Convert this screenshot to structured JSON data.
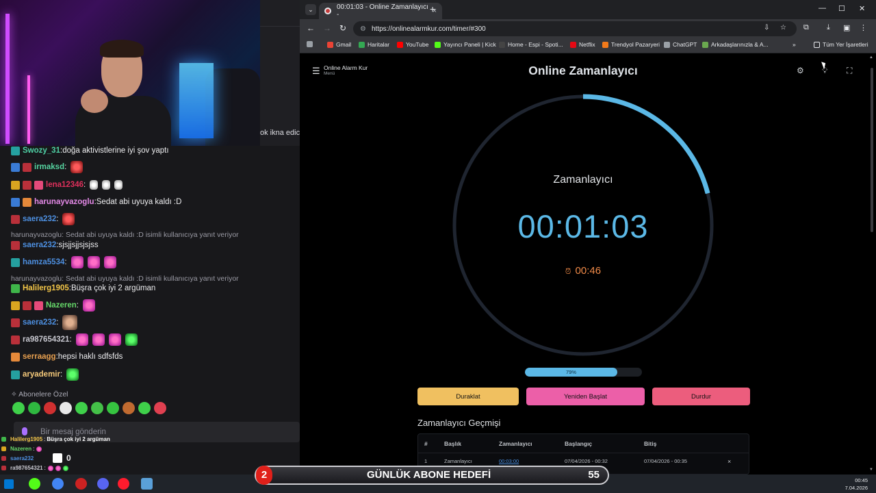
{
  "chat": {
    "overflow_fragment": "ok ikna edici",
    "messages": [
      {
        "user": "Swozy_31",
        "sep": ":",
        "text": " doğa aktivistlerine iyi şov yaptı",
        "color": "#4fd1a5"
      },
      {
        "user": "irmaksd",
        "sep": ":",
        "text": "",
        "color": "#56d4a0"
      },
      {
        "user": "lena12346",
        "sep": ":",
        "text": "",
        "color": "#e0305c"
      },
      {
        "user": "harunayvazoglu",
        "sep": ":",
        "text": " Sedat abi uyuya kaldı :D",
        "color": "#e58ae8"
      },
      {
        "user": "saera232",
        "sep": ":",
        "text": "",
        "color": "#4d8fe0"
      },
      {
        "user": "saera232",
        "sep": ":",
        "text": " sjsjjsjjsjsjss",
        "color": "#4d8fe0"
      },
      {
        "user": "hamza5534",
        "sep": ":",
        "text": "",
        "color": "#4d8fe0"
      },
      {
        "user": "Halilerg1905",
        "sep": ":",
        "text": " Büşra çok iyi 2 argüman",
        "color": "#f2c548"
      },
      {
        "user": "Nazeren",
        "sep": ":",
        "text": "",
        "color": "#66d96a"
      },
      {
        "user": "saera232",
        "sep": ":",
        "text": "",
        "color": "#4d8fe0"
      },
      {
        "user": "ra987654321",
        "sep": ":",
        "text": "",
        "color": "#c8c8d0"
      },
      {
        "user": "serraagg",
        "sep": ":",
        "text": " hepsi haklı sdfsfds",
        "color": "#e8a050"
      },
      {
        "user": "aryademir",
        "sep": ":",
        "text": "",
        "color": "#f5c97a"
      }
    ],
    "replies": [
      "harunayvazoglu: Sedat abi uyuya kaldı :D isimli kullanıcıya yanıt veriyor",
      "harunayvazoglu: Sedat abi uyuya kaldı :D isimli kullanıcıya yanıt veriyor"
    ],
    "subscriber_label": "Abonelere Özel",
    "input_placeholder": "Bir mesaj gönderin",
    "overlay_lines": [
      {
        "user": "Halilerg1905",
        "text": "Büşra çok iyi 2 argüman"
      },
      {
        "user": "Nazeren",
        "text": ""
      },
      {
        "user": "saera232",
        "text": ""
      },
      {
        "user": "ra987654321",
        "text": ""
      }
    ],
    "counter": "0"
  },
  "browser": {
    "tab_title": "00:01:03 - Online Zamanlayıcı -",
    "url": "https://onlinealarmkur.com/timer/#300",
    "bookmarks": [
      "Gmail",
      "Haritalar",
      "YouTube",
      "Yayıncı Paneli | Kick",
      "Home - Espi - Spoti...",
      "Netflix",
      "Trendyol Pazaryeri",
      "ChatGPT",
      "Arkadaşlarınızla & A...",
      "Tüm Yer İşaretleri"
    ]
  },
  "app": {
    "menu_title": "Online Alarm Kur",
    "menu_subtitle": "Menü",
    "page_title": "Online Zamanlayıcı",
    "timer_label": "Zamanlayıcı",
    "timer_time": "00:01:03",
    "alarm_time": "00:46",
    "progress_label": "79%",
    "progress_value": 79,
    "ring_fraction": 0.21,
    "buttons": {
      "pause": "Duraklat",
      "restart": "Yeniden Başlat",
      "stop": "Durdur"
    },
    "history_title": "Zamanlayıcı Geçmişi",
    "history_columns": [
      "#",
      "Başlık",
      "Zamanlayıcı",
      "Başlangıç",
      "Bitiş"
    ],
    "history_rows": [
      {
        "no": "1",
        "title": "Zamanlayıcı",
        "timer": "00:03:00",
        "start": "07/04/2026 - 00:32",
        "end": "07/04/2026 - 00:35",
        "action": "×"
      }
    ]
  },
  "goal": {
    "number": "2",
    "label": "GÜNLÜK ABONE HEDEFİ",
    "value": "55"
  },
  "taskbar": {
    "time": "00:45",
    "date": "7.04.2026"
  },
  "colors": {
    "accent": "#5bb8e6",
    "alarm": "#f08a48",
    "pause": "#f0c060",
    "restart": "#ec5fa8",
    "stop": "#ec5d7d"
  }
}
